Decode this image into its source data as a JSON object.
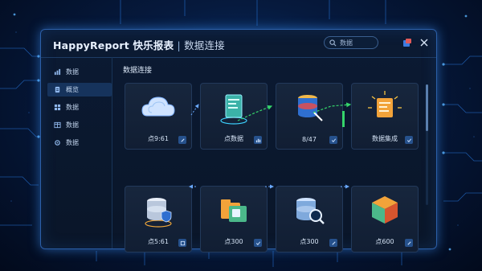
{
  "app": {
    "brand": "HappyReport",
    "brand_cn": "快乐报表",
    "separator": " | ",
    "subtitle": "数据连接"
  },
  "search": {
    "placeholder": "数据",
    "icon": "search-icon"
  },
  "titlebar_icons": [
    "app-logo-icon",
    "close-icon"
  ],
  "sidebar": {
    "items": [
      {
        "label": "数据",
        "icon": "bar-chart-icon",
        "active": false
      },
      {
        "label": "概览",
        "icon": "document-icon",
        "active": true
      },
      {
        "label": "数据",
        "icon": "grid-icon",
        "active": false
      },
      {
        "label": "数据",
        "icon": "table-icon",
        "active": false
      },
      {
        "label": "数据",
        "icon": "settings-icon",
        "active": false
      }
    ]
  },
  "main": {
    "section_title": "数据连接",
    "cards": [
      {
        "label": "点9:61",
        "icon": "cloud-icon",
        "badge": "chevron-icon"
      },
      {
        "label": "点数据",
        "icon": "document-icon",
        "badge": "bars-icon"
      },
      {
        "label": "8/47",
        "icon": "database-edit-icon",
        "badge": "check-icon"
      },
      {
        "label": "数据集成",
        "icon": "file-glow-icon",
        "badge": "check-icon"
      },
      {
        "label": "点5:61",
        "icon": "database-shield-icon",
        "badge": "square-icon"
      },
      {
        "label": "点300",
        "icon": "folder-box-icon",
        "badge": "check-icon"
      },
      {
        "label": "点300",
        "icon": "database-search-icon",
        "badge": "chevron-icon"
      },
      {
        "label": "点600",
        "icon": "cube-icon",
        "badge": "chevron-icon"
      }
    ]
  },
  "colors": {
    "accent": "#2f7bff",
    "border": "#2c5fa8",
    "card_bg": "#17263d",
    "glow_green": "#35d46b"
  }
}
